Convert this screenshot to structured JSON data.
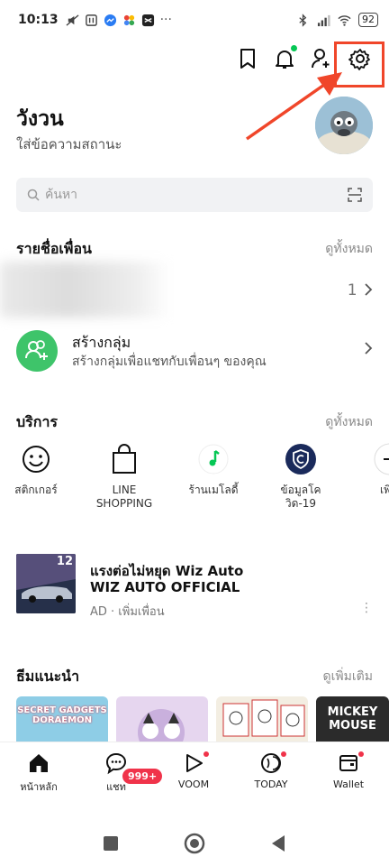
{
  "status_bar": {
    "time": "10:13",
    "battery": "92"
  },
  "profile": {
    "name": "วังวน",
    "status": "ใส่ข้อความสถานะ"
  },
  "search": {
    "placeholder": "ค้นหา"
  },
  "friends": {
    "title": "รายชื่อเพื่อน",
    "see_all": "ดูทั้งหมด",
    "count": "1",
    "create_group_title": "สร้างกลุ่ม",
    "create_group_sub": "สร้างกลุ่มเพื่อแชทกับเพื่อนๆ ของคุณ"
  },
  "services": {
    "title": "บริการ",
    "see_all": "ดูทั้งหมด",
    "items": [
      {
        "label": "สติกเกอร์",
        "icon": "smiley-icon"
      },
      {
        "label": "LINE SHOPPING",
        "icon": "shopping-bag-icon"
      },
      {
        "label": "ร้านเมโลดี้",
        "icon": "music-note-icon"
      },
      {
        "label": "ข้อมูลโควิด-19",
        "icon": "covid-shield-icon"
      },
      {
        "label": "เพิ่",
        "icon": "plus-icon"
      }
    ]
  },
  "ad": {
    "title": "แรงต่อไม่หยุด Wiz Auto",
    "account": "WIZ AUTO OFFICIAL",
    "meta": "AD · เพิ่มเพื่อน",
    "thumb_badge": "12"
  },
  "themes": {
    "title": "ธีมแนะนำ",
    "see_more": "ดูเพิ่มเติม",
    "items": [
      "SECRET GADGETS DORAEMON",
      "",
      "",
      "MICKEY MOUSE"
    ]
  },
  "nav": {
    "items": [
      "หน้าหลัก",
      "แชท",
      "VOOM",
      "TODAY",
      "Wallet"
    ],
    "chat_badge": "999+"
  },
  "colors": {
    "accent": "#06c755",
    "highlight": "#f0462a",
    "badge": "#f0334a"
  }
}
